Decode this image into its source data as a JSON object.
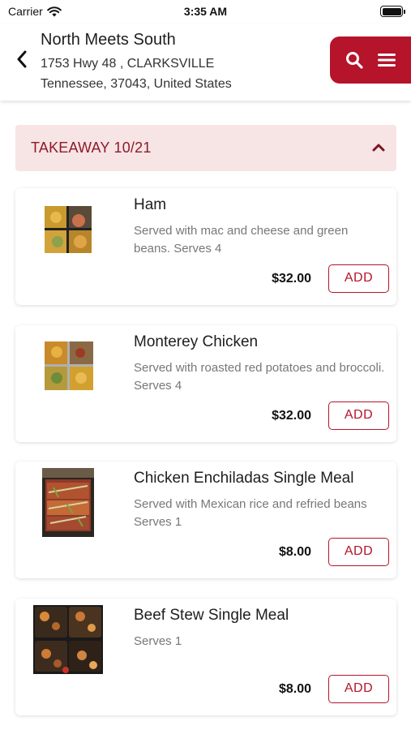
{
  "status_bar": {
    "carrier": "Carrier",
    "time": "3:35 AM"
  },
  "header": {
    "store_name": "North Meets South",
    "address_line1": "1753 Hwy 48 , CLARKSVILLE",
    "address_line2": "Tennessee, 37043, United States",
    "accent_color": "#b5142a"
  },
  "section": {
    "title": "TAKEAWAY 10/21",
    "expanded": true
  },
  "items": [
    {
      "name": "Ham",
      "description": "Served with mac and cheese and green beans. Serves 4",
      "price": "$32.00",
      "add_label": "ADD",
      "image": "ham-photo"
    },
    {
      "name": "Monterey Chicken",
      "description": "Served with roasted red potatoes and broccoli. Serves 4",
      "price": "$32.00",
      "add_label": "ADD",
      "image": "monterey-chicken-photo"
    },
    {
      "name": "Chicken Enchiladas Single Meal",
      "description": "Served with Mexican rice and refried beans Serves 1",
      "price": "$8.00",
      "add_label": "ADD",
      "image": "chicken-enchiladas-photo"
    },
    {
      "name": "Beef Stew Single Meal",
      "description": "Serves 1",
      "price": "$8.00",
      "add_label": "ADD",
      "image": "beef-stew-photo"
    }
  ]
}
